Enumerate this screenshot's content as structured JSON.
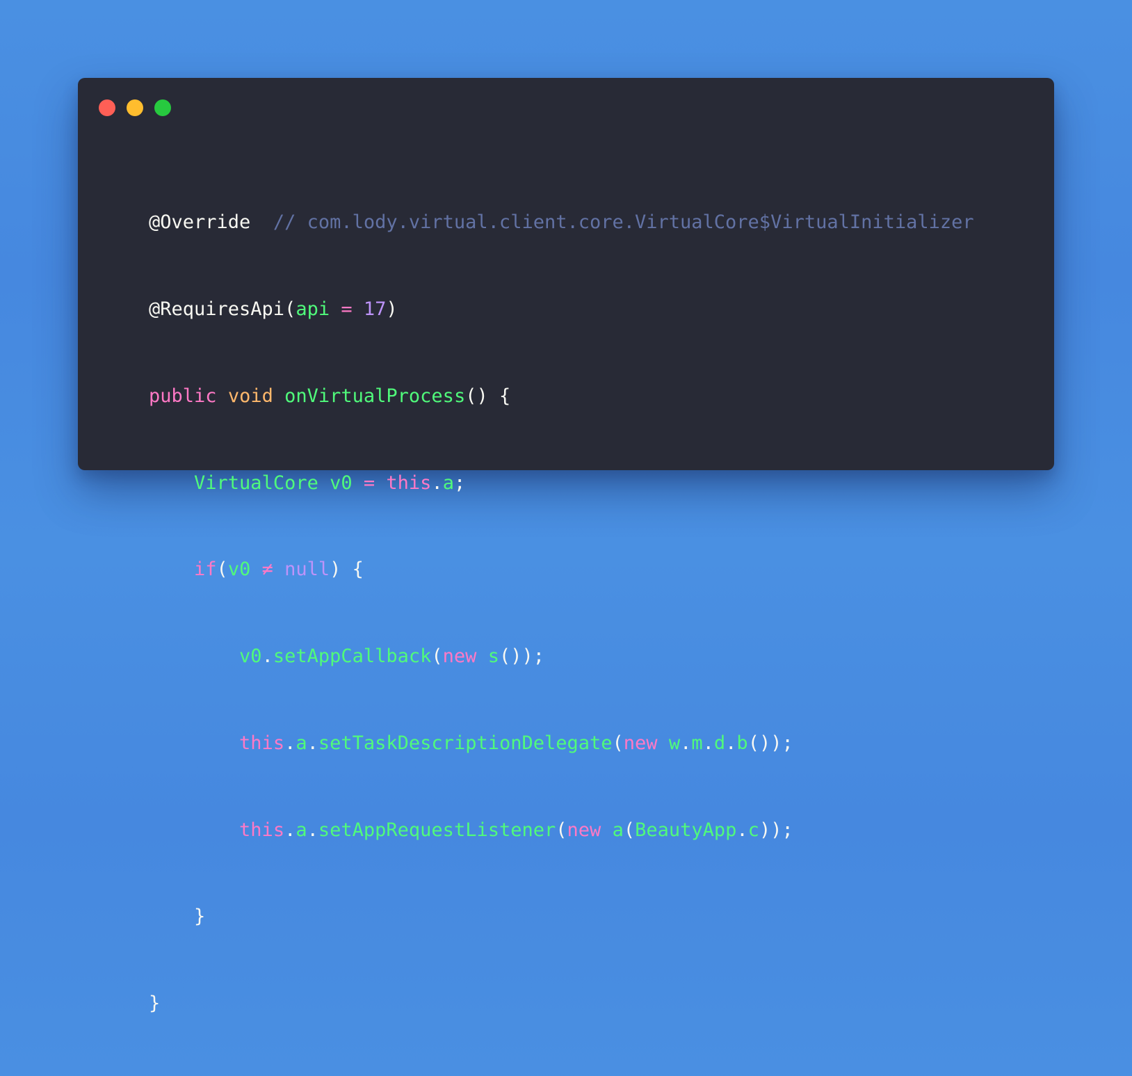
{
  "window": {
    "controls": [
      {
        "name": "close",
        "color": "#ff5f56"
      },
      {
        "name": "minimize",
        "color": "#ffbd2e"
      },
      {
        "name": "zoom",
        "color": "#27c93f"
      }
    ]
  },
  "code": {
    "line1": {
      "annotation": "@Override",
      "comment": "// com.lody.virtual.client.core.VirtualCore$VirtualInitializer"
    },
    "line2": {
      "annotation": "@RequiresApi(",
      "param": "api",
      "eq": " = ",
      "value": "17",
      "close": ")"
    },
    "line3": {
      "kw": "public",
      "type": "void",
      "name": "onVirtualProcess",
      "rest": "() {"
    },
    "line4": {
      "type": "VirtualCore",
      "var": "v0",
      "eq": " = ",
      "this": "this",
      "dot": ".",
      "field": "a",
      "end": ";"
    },
    "line5": {
      "kw": "if",
      "open": "(",
      "var": "v0",
      "op": " ≠ ",
      "null": "null",
      "close": ") {"
    },
    "line6": {
      "var": "v0",
      "dot": ".",
      "method": "setAppCallback",
      "open": "(",
      "new": "new",
      "cls": "s",
      "end": "());"
    },
    "line7": {
      "this": "this",
      "dot1": ".",
      "field": "a",
      "dot2": ".",
      "method": "setTaskDescriptionDelegate",
      "open": "(",
      "new": "new",
      "p1": "w",
      "d1": ".",
      "p2": "m",
      "d2": ".",
      "p3": "d",
      "d3": ".",
      "p4": "b",
      "end": "());"
    },
    "line8": {
      "this": "this",
      "dot1": ".",
      "field": "a",
      "dot2": ".",
      "method": "setAppRequestListener",
      "open": "(",
      "new": "new",
      "cls": "a",
      "open2": "(",
      "arg": "BeautyApp",
      "dot3": ".",
      "argField": "c",
      "end": "));"
    },
    "line9": {
      "brace": "}"
    },
    "line10": {
      "brace": "}"
    }
  }
}
